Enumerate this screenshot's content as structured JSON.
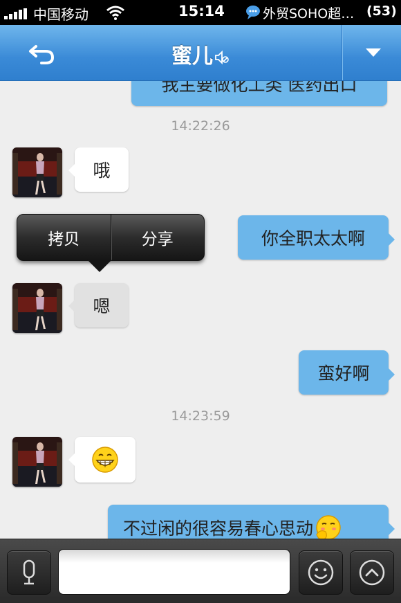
{
  "status_bar": {
    "carrier": "中国移动",
    "time": "15:14",
    "notification": "外贸SOHO超…",
    "notification_count": "(53)"
  },
  "header": {
    "title": "蜜儿",
    "back_icon": "back-arrow-icon",
    "mute_icon": "mute-icon",
    "menu_icon": "dropdown-triangle-icon"
  },
  "colors": {
    "nav_blue": "#3a8ad7",
    "outgoing_bubble": "#6cb6ea",
    "incoming_bubble": "#ffffff"
  },
  "messages": {
    "m0": "我主要做化工类 医药出口",
    "ts1": "14:22:26",
    "m1": "哦",
    "m2": "你全职太太啊",
    "m3": "嗯",
    "m4": "蛮好啊",
    "ts2": "14:23:59",
    "m5_icon": "grin-emoji",
    "m6": "不过闲的很容易春心思动",
    "m6_emoji": "shy-emoji"
  },
  "popup": {
    "copy": "拷贝",
    "share": "分享"
  },
  "input_bar": {
    "voice_icon": "microphone-icon",
    "emoji_icon": "smiley-icon",
    "more_icon": "chevron-up-icon",
    "text": ""
  }
}
